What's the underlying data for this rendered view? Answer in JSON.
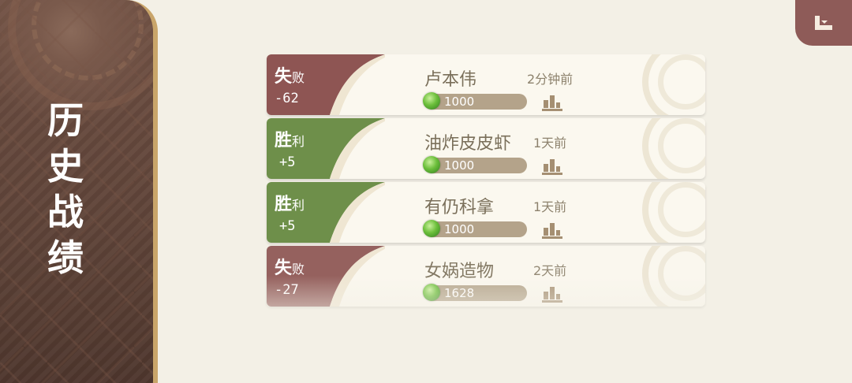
{
  "sidebar": {
    "title": "历史战绩"
  },
  "header": {
    "back_icon": "back-arrow-icon"
  },
  "colors": {
    "loss": "#8e5553",
    "win": "#6e8f4a",
    "rating_bar": "#b4a38a",
    "orb": "#6cbf3b"
  },
  "matches": [
    {
      "result_main": "失",
      "result_sub": "败",
      "score": "-62",
      "outcome": "loss",
      "player": "卢本伟",
      "time": "2分钟前",
      "rating": "1000"
    },
    {
      "result_main": "胜",
      "result_sub": "利",
      "score": "+5",
      "outcome": "win",
      "player": "油炸皮皮虾",
      "time": "1天前",
      "rating": "1000"
    },
    {
      "result_main": "胜",
      "result_sub": "利",
      "score": "+5",
      "outcome": "win",
      "player": "有仍科拿",
      "time": "1天前",
      "rating": "1000"
    },
    {
      "result_main": "失",
      "result_sub": "败",
      "score": "-27",
      "outcome": "loss",
      "player": "女娲造物",
      "time": "2天前",
      "rating": "1628"
    }
  ]
}
